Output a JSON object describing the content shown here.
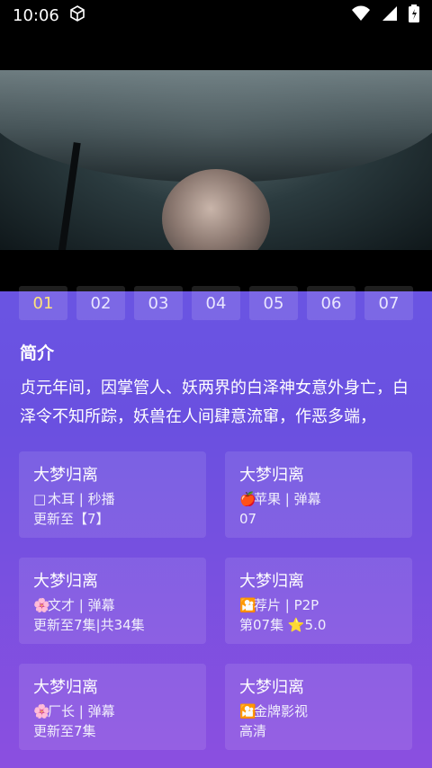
{
  "status": {
    "time": "10:06",
    "colors": {
      "bar": "#000000"
    },
    "icons": [
      "box-icon",
      "wifi-icon",
      "signal-icon",
      "battery-icon"
    ]
  },
  "episodes": [
    "01",
    "02",
    "03",
    "04",
    "05",
    "06",
    "07"
  ],
  "synopsis": {
    "title": "简介",
    "text": "贞元年间，因掌管人、妖两界的白泽神女意外身亡，白泽令不知所踪，妖兽在人间肆意流窜，作恶多端，"
  },
  "sources": [
    {
      "title": "大梦归离",
      "icon": "□",
      "source": "木耳 | 秒播",
      "update": "更新至【7】"
    },
    {
      "title": "大梦归离",
      "icon": "🍎",
      "source": "苹果 | 弹幕",
      "update": "07"
    },
    {
      "title": "大梦归离",
      "icon": "🌸",
      "source": "文才 | 弹幕",
      "update": "更新至7集|共34集"
    },
    {
      "title": "大梦归离",
      "icon": "🎦",
      "source": "荐片 | P2P",
      "update": "第07集 ⭐5.0"
    },
    {
      "title": "大梦归离",
      "icon": "🌸",
      "source": "厂长 | 弹幕",
      "update": "更新至7集"
    },
    {
      "title": "大梦归离",
      "icon": "🎦",
      "source": "金牌影视",
      "update": "高清"
    }
  ],
  "theme": {
    "active_episode_color": "#ffe37a"
  }
}
